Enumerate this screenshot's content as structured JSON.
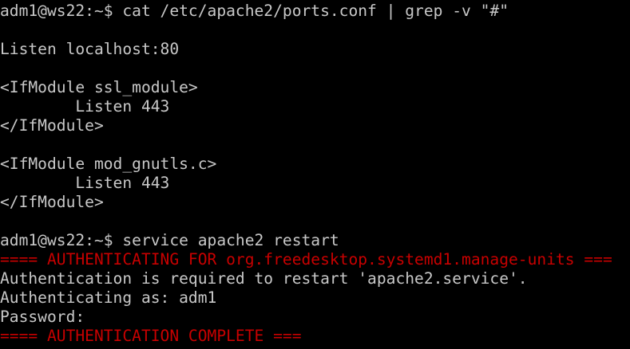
{
  "terminal": {
    "colors": {
      "background": "#000000",
      "text": "#c8c8c8",
      "alert": "#c80000"
    },
    "lines": [
      {
        "text": "adm1@ws22:~$ cat /etc/apache2/ports.conf | grep -v \"#\"",
        "style": "normal"
      },
      {
        "text": "",
        "style": "normal"
      },
      {
        "text": "Listen localhost:80",
        "style": "normal"
      },
      {
        "text": "",
        "style": "normal"
      },
      {
        "text": "<IfModule ssl_module>",
        "style": "normal"
      },
      {
        "text": "        Listen 443",
        "style": "normal"
      },
      {
        "text": "</IfModule>",
        "style": "normal"
      },
      {
        "text": "",
        "style": "normal"
      },
      {
        "text": "<IfModule mod_gnutls.c>",
        "style": "normal"
      },
      {
        "text": "        Listen 443",
        "style": "normal"
      },
      {
        "text": "</IfModule>",
        "style": "normal"
      },
      {
        "text": "",
        "style": "normal"
      },
      {
        "text": "adm1@ws22:~$ service apache2 restart",
        "style": "normal"
      },
      {
        "text": "==== AUTHENTICATING FOR org.freedesktop.systemd1.manage-units ===",
        "style": "red"
      },
      {
        "text": "Authentication is required to restart 'apache2.service'.",
        "style": "normal"
      },
      {
        "text": "Authenticating as: adm1",
        "style": "normal"
      },
      {
        "text": "Password:",
        "style": "normal"
      },
      {
        "text": "==== AUTHENTICATION COMPLETE ===",
        "style": "red"
      }
    ]
  }
}
